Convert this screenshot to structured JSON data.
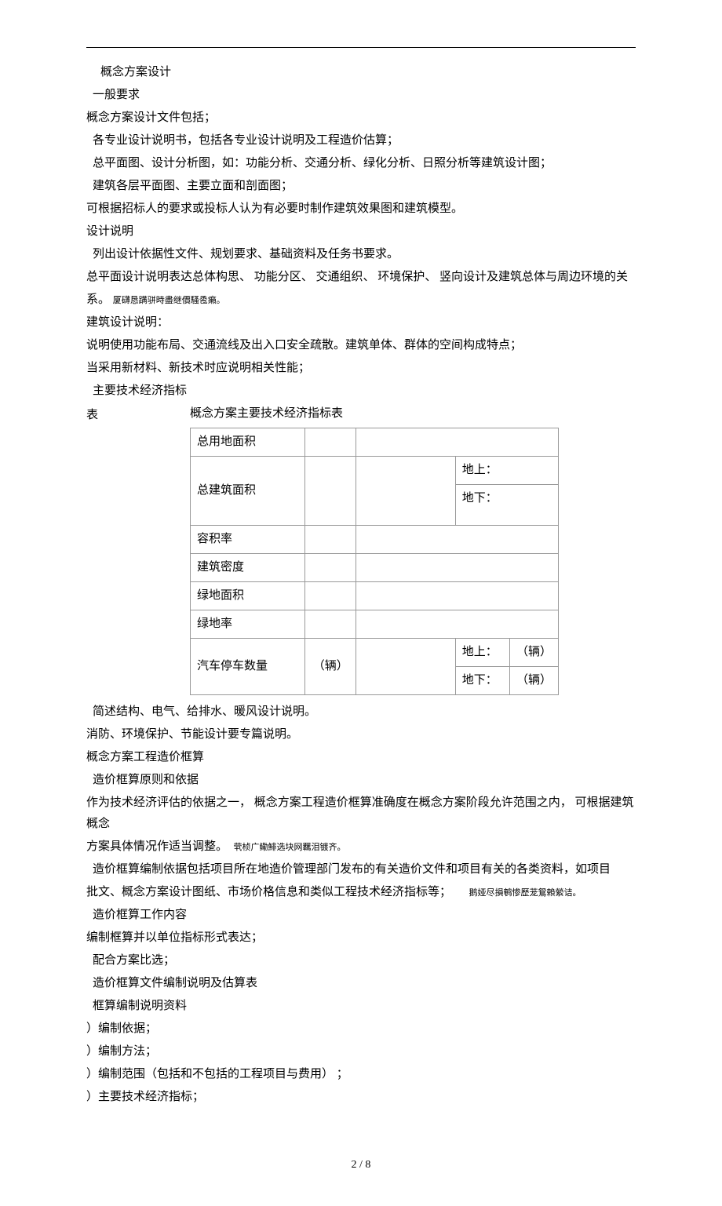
{
  "lines": {
    "l1": "概念方案设计",
    "l2": "一般要求",
    "l3": "概念方案设计文件包括；",
    "l4": "各专业设计说明书，包括各专业设计说明及工程造价估算；",
    "l5": "总平面图、设计分析图，如：功能分析、交通分析、绿化分析、日照分析等建筑设计图；",
    "l6": "建筑各层平面图、主要立面和剖面图；",
    "l7": "可根据招标人的要求或投标人认为有必要时制作建筑效果图和建筑模型。",
    "l8": "设计说明",
    "l9": "列出设计依据性文件、规划要求、基础资料及任务书要求。",
    "l10": "总平面设计说明表达总体构思、    功能分区、  交通组织、  环境保护、  竖向设计及建筑总体与周边环境的关",
    "l10b": "系。",
    "l10c": "厦礴恳蹒骈時盡继價騷卺癩。",
    "l11": "建筑设计说明：",
    "l12": "说明使用功能布局、交通流线及出入口安全疏散。建筑单体、群体的空间构成特点；",
    "l13": "当采用新材料、新技术时应说明相关性能；",
    "l14": "主要技术经济指标",
    "l15": "表",
    "tableTitle": "概念方案主要技术经济指标表",
    "l16": "简述结构、电气、给排水、暖风设计说明。",
    "l17": "消防、环境保护、节能设计要专篇说明。",
    "l18": "概念方案工程造价框算",
    "l19": "造价框算原则和依据",
    "l20a": "作为技术经济评估的依据之一，  概念方案工程造价框算准确度在概念方案阶段允许范围之内，  可根据建筑概念",
    "l20b": "方案具体情况作适当调整。",
    "l20c": "茕桢广鳓鯡选块网羈泪镀齐。",
    "l21a": "造价框算编制依据包括项目所在地造价管理部门发布的有关造价文件和项目有关的各类资料，如项目",
    "l21b": "批文、概念方案设计图纸、市场价格信息和类似工程技术经济指标等；",
    "l21c": "鹅娅尽損鹌惨歷茏鴛賴縈诘。",
    "l22": "造价框算工作内容",
    "l23": "编制框算并以单位指标形式表达；",
    "l24": "配合方案比选；",
    "l25": "造价框算文件编制说明及估算表",
    "l26": "框算编制说明资料",
    "l27": "）编制依据；",
    "l28": "）编制方法；",
    "l29": "）编制范围（包括和不包括的工程项目与费用）    ；",
    "l30": "）主要技术经济指标；"
  },
  "table": {
    "r1_label": "总用地面积",
    "r2_label": "总建筑面积",
    "r2_above": "地上：",
    "r2_below": "地下：",
    "r3_label": "容积率",
    "r4_label": "建筑密度",
    "r5_label": "绿地面积",
    "r6_label": "绿地率",
    "r7_label": "汽车停车数量",
    "r7_unit": "（辆）",
    "r7_above": "地上：",
    "r7_above_unit": "（辆）",
    "r7_below": "地下：",
    "r7_below_unit": "（辆）"
  },
  "pageNum": "2 / 8"
}
